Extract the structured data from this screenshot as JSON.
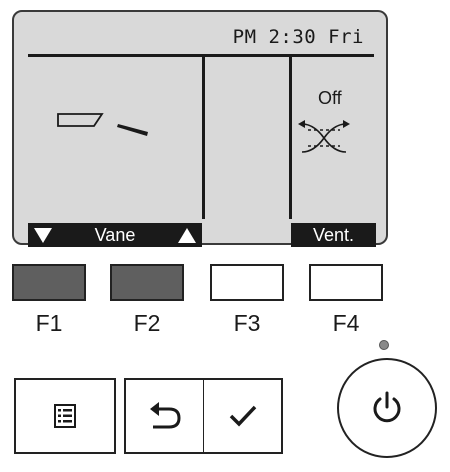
{
  "display": {
    "clock": "PM 2:30 Fri",
    "vent_status": "Off",
    "softkeys": {
      "vane_label": "Vane",
      "vent_label": "Vent."
    }
  },
  "function_keys": [
    {
      "label": "F1",
      "state": "active"
    },
    {
      "label": "F2",
      "state": "active"
    },
    {
      "label": "F3",
      "state": "inactive"
    },
    {
      "label": "F4",
      "state": "inactive"
    }
  ],
  "buttons": {
    "menu_icon": "menu-list-icon",
    "return_icon": "return-arrow-icon",
    "ok_icon": "checkmark-icon",
    "power_icon": "power-icon"
  },
  "colors": {
    "lcd_background": "#d9d9d9",
    "active_key": "#5f5f5f",
    "ink": "#1a1a1a"
  }
}
